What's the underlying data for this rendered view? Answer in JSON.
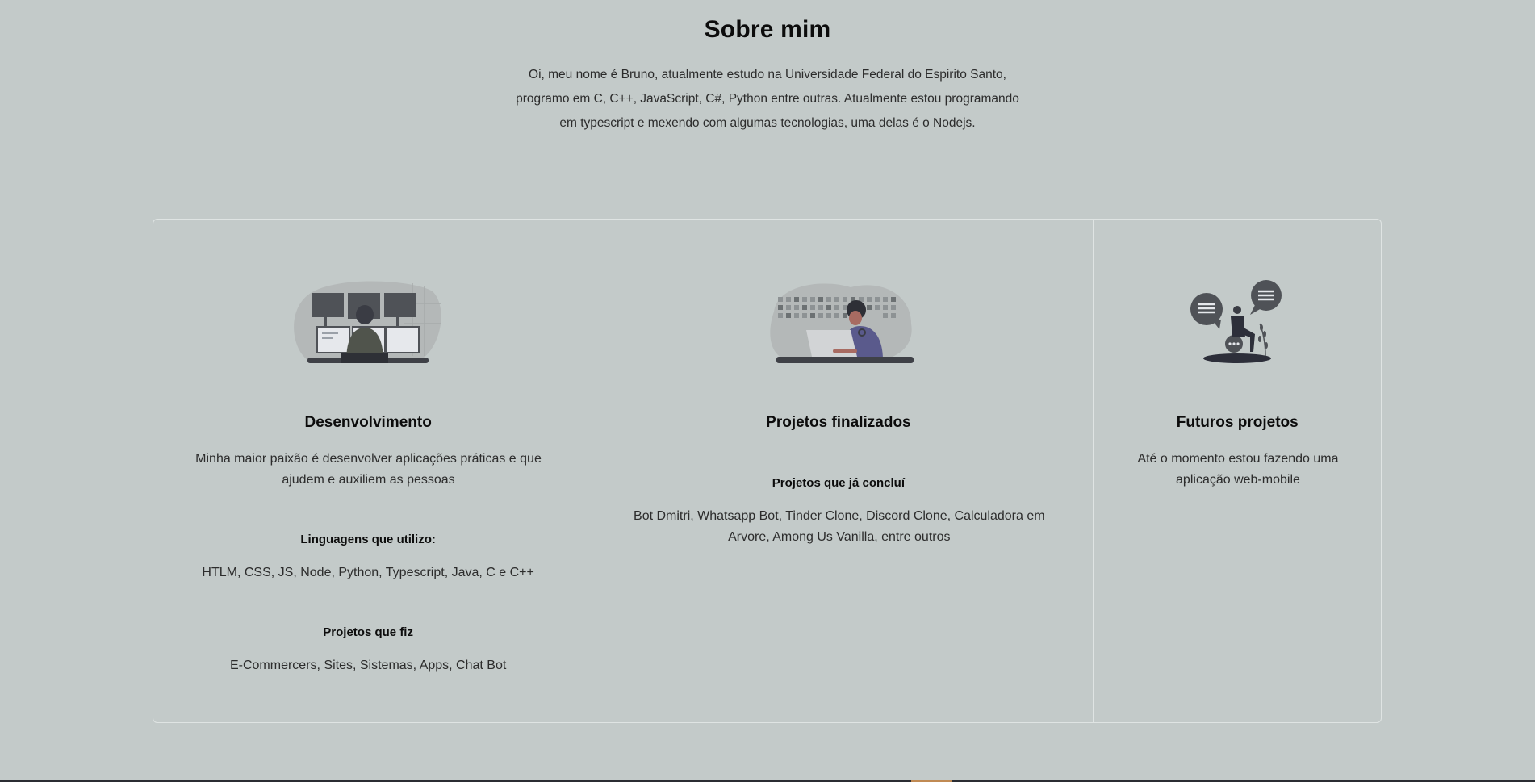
{
  "about": {
    "title": "Sobre mim",
    "lines": [
      "Oi, meu nome é Bruno, atualmente estudo na Universidade Federal do Espirito Santo,",
      "programo em C, C++, JavaScript, C#, Python entre outras. Atualmente estou programando",
      "em typescript e mexendo com algumas tecnologias, uma delas é o Nodejs."
    ]
  },
  "cards": [
    {
      "title": "Desenvolvimento",
      "description": "Minha maior paixão é desenvolver aplicações práticas e que ajudem e auxiliem as pessoas",
      "sections": [
        {
          "subtitle": "Linguagens que utilizo:",
          "text": "HTLM, CSS, JS, Node, Python, Typescript, Java, C e C++"
        },
        {
          "subtitle": "Projetos que fiz",
          "text": "E-Commercers, Sites, Sistemas, Apps, Chat Bot"
        }
      ]
    },
    {
      "title": "Projetos finalizados",
      "sections": [
        {
          "subtitle": "Projetos que já concluí",
          "text": "Bot Dmitri, Whatsapp Bot, Tinder Clone, Discord Clone, Calculadora em Arvore, Among Us Vanilla, entre outros"
        }
      ]
    },
    {
      "title": "Futuros projetos",
      "description": "Até o momento estou fazendo uma aplicação web-mobile"
    }
  ],
  "colors": {
    "background": "#c3cac9",
    "card_border": "#dfe4e3",
    "heading": "#0c0c0c",
    "text": "#2c2c2c",
    "illustration_accent": "#5a5a8c"
  },
  "icons": [
    "developer-monitors-illustration",
    "laptop-worker-illustration",
    "chat-bubbles-illustration"
  ]
}
